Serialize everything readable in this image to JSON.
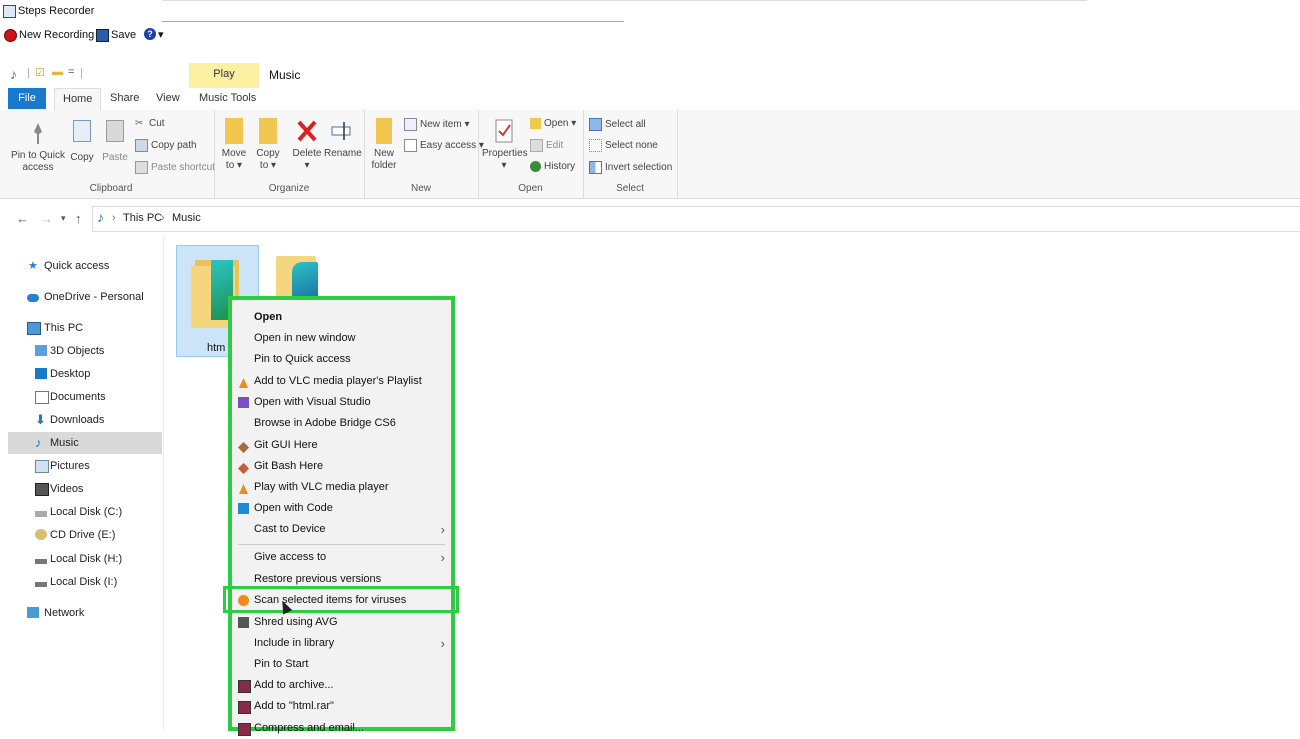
{
  "steps_recorder": {
    "title": "Steps Recorder",
    "new_recording": "New Recording",
    "save": "Save",
    "help_glyph": "?",
    "help_dropdown": "▾"
  },
  "explorer": {
    "quick_access_glyphs": [
      "♪",
      "|",
      "☑",
      "▬",
      "=",
      "|"
    ],
    "contextual_tab": "Play",
    "title": "Music",
    "tabs": [
      "File",
      "Home",
      "Share",
      "View",
      "Music Tools"
    ],
    "ribbon": {
      "clipboard": {
        "label": "Clipboard",
        "pin": "Pin to Quick access",
        "copy": "Copy",
        "paste": "Paste",
        "cut": "Cut",
        "copy_path": "Copy path",
        "paste_shortcut": "Paste shortcut"
      },
      "organize": {
        "label": "Organize",
        "move_to": "Move to ▾",
        "copy_to": "Copy to ▾",
        "delete": "Delete ▾",
        "rename": "Rename"
      },
      "new": {
        "label": "New",
        "new_folder": "New folder",
        "new_item": "New item ▾",
        "easy_access": "Easy access ▾"
      },
      "open": {
        "label": "Open",
        "properties": "Properties ▾",
        "open": "Open ▾",
        "edit": "Edit",
        "history": "History"
      },
      "select": {
        "label": "Select",
        "select_all": "Select all",
        "select_none": "Select none",
        "invert_selection": "Invert selection"
      }
    },
    "address": {
      "back": "←",
      "forward": "→",
      "recent": "▾",
      "up": "↑",
      "sep1": "›",
      "sep2": "›",
      "crumbs": [
        "This PC",
        "Music"
      ]
    },
    "sidebar": [
      "Quick access",
      "OneDrive - Personal",
      "This PC",
      "3D Objects",
      "Desktop",
      "Documents",
      "Downloads",
      "Music",
      "Pictures",
      "Videos",
      "Local Disk (C:)",
      "CD Drive (E:)",
      "Local Disk (H:)",
      "Local Disk (I:)",
      "Network"
    ],
    "selected_sidebar": "Music",
    "file_label": "htm"
  },
  "context_menu": {
    "items": [
      "Open",
      "Open in new window",
      "Pin to Quick access",
      "Add to VLC media player's Playlist",
      "Open with Visual Studio",
      "Browse in Adobe Bridge CS6",
      "Git GUI Here",
      "Git Bash Here",
      "Play with VLC media player",
      "Open with Code",
      "Cast to Device",
      "Give access to",
      "Restore previous versions",
      "Scan selected items for viruses",
      "Shred using AVG",
      "Include in library",
      "Pin to Start",
      "Add to archive...",
      "Add to \"html.rar\"",
      "Compress and email..."
    ],
    "submenu_arrow": "›",
    "highlight_color": "#2ecc40"
  }
}
